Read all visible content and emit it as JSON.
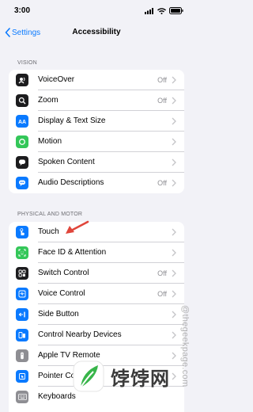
{
  "status_bar": {
    "time": "3:00"
  },
  "nav": {
    "back_label": "Settings",
    "title": "Accessibility"
  },
  "sections": [
    {
      "header": "VISION",
      "rows": [
        {
          "label": "VoiceOver",
          "value": "Off",
          "icon": "voiceover-icon",
          "color": "#1c1c1e"
        },
        {
          "label": "Zoom",
          "value": "Off",
          "icon": "zoom-icon",
          "color": "#1c1c1e"
        },
        {
          "label": "Display & Text Size",
          "value": "",
          "icon": "text-size-icon",
          "color": "#0a7aff"
        },
        {
          "label": "Motion",
          "value": "",
          "icon": "motion-icon",
          "color": "#34c759"
        },
        {
          "label": "Spoken Content",
          "value": "",
          "icon": "spoken-content-icon",
          "color": "#1c1c1e"
        },
        {
          "label": "Audio Descriptions",
          "value": "Off",
          "icon": "audio-descriptions-icon",
          "color": "#0a7aff"
        }
      ]
    },
    {
      "header": "PHYSICAL AND MOTOR",
      "rows": [
        {
          "label": "Touch",
          "value": "",
          "icon": "touch-icon",
          "color": "#0a7aff"
        },
        {
          "label": "Face ID & Attention",
          "value": "",
          "icon": "face-id-icon",
          "color": "#34c759"
        },
        {
          "label": "Switch Control",
          "value": "Off",
          "icon": "switch-control-icon",
          "color": "#1c1c1e"
        },
        {
          "label": "Voice Control",
          "value": "Off",
          "icon": "voice-control-icon",
          "color": "#0a7aff"
        },
        {
          "label": "Side Button",
          "value": "",
          "icon": "side-button-icon",
          "color": "#0a7aff"
        },
        {
          "label": "Control Nearby Devices",
          "value": "",
          "icon": "nearby-devices-icon",
          "color": "#0a7aff"
        },
        {
          "label": "Apple TV Remote",
          "value": "",
          "icon": "tv-remote-icon",
          "color": "#8e8e93"
        },
        {
          "label": "Pointer Co",
          "value": "",
          "icon": "pointer-control-icon",
          "color": "#0a7aff"
        },
        {
          "label": "Keyboards",
          "value": "",
          "icon": "keyboard-icon",
          "color": "#8e8e93"
        }
      ]
    }
  ],
  "watermark": "@thegeekpage.com",
  "logo": {
    "text": "饽饽网"
  },
  "colors": {
    "accent": "#0a7aff",
    "background": "#f2f2f7",
    "annotation_arrow": "#e0453a"
  }
}
